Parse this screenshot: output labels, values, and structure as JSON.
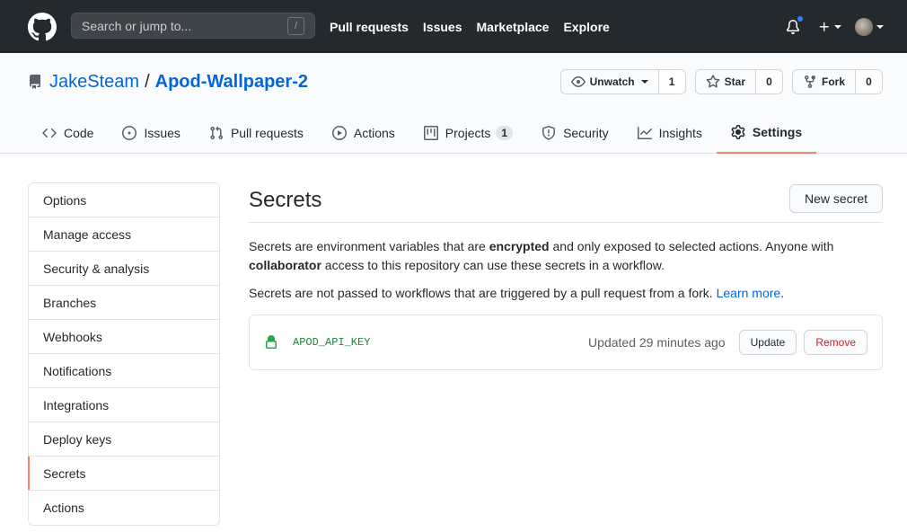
{
  "header": {
    "search_placeholder": "Search or jump to...",
    "search_shortcut": "/",
    "nav": [
      "Pull requests",
      "Issues",
      "Marketplace",
      "Explore"
    ]
  },
  "repo": {
    "owner": "JakeSteam",
    "separator": "/",
    "name": "Apod-Wallpaper-2",
    "watch": {
      "label": "Unwatch",
      "count": "1"
    },
    "star": {
      "label": "Star",
      "count": "0"
    },
    "fork": {
      "label": "Fork",
      "count": "0"
    }
  },
  "tabs": [
    {
      "label": "Code",
      "icon": "code-icon"
    },
    {
      "label": "Issues",
      "icon": "issue-icon"
    },
    {
      "label": "Pull requests",
      "icon": "pull-request-icon"
    },
    {
      "label": "Actions",
      "icon": "play-icon"
    },
    {
      "label": "Projects",
      "icon": "project-icon",
      "counter": "1"
    },
    {
      "label": "Security",
      "icon": "shield-icon"
    },
    {
      "label": "Insights",
      "icon": "graph-icon"
    },
    {
      "label": "Settings",
      "icon": "gear-icon",
      "selected": true
    }
  ],
  "menu": [
    "Options",
    "Manage access",
    "Security & analysis",
    "Branches",
    "Webhooks",
    "Notifications",
    "Integrations",
    "Deploy keys",
    "Secrets",
    "Actions"
  ],
  "menu_selected": "Secrets",
  "main": {
    "title": "Secrets",
    "new_secret_label": "New secret",
    "desc_part1": "Secrets are environment variables that are ",
    "desc_bold1": "encrypted",
    "desc_part2": " and only exposed to selected actions. Anyone with ",
    "desc_bold2": "collaborator",
    "desc_part3": " access to this repository can use these secrets in a workflow.",
    "desc2_text": "Secrets are not passed to workflows that are triggered by a pull request from a fork. ",
    "desc2_link": "Learn more",
    "desc2_end": "."
  },
  "secret": {
    "name": "APOD_API_KEY",
    "updated": "Updated 29 minutes ago",
    "update_label": "Update",
    "remove_label": "Remove"
  },
  "colors": {
    "header_bg": "#24292e",
    "link": "#0366d6",
    "tab_underline": "#f9826c",
    "secret_name": "#22863a",
    "danger": "#cb2431"
  }
}
